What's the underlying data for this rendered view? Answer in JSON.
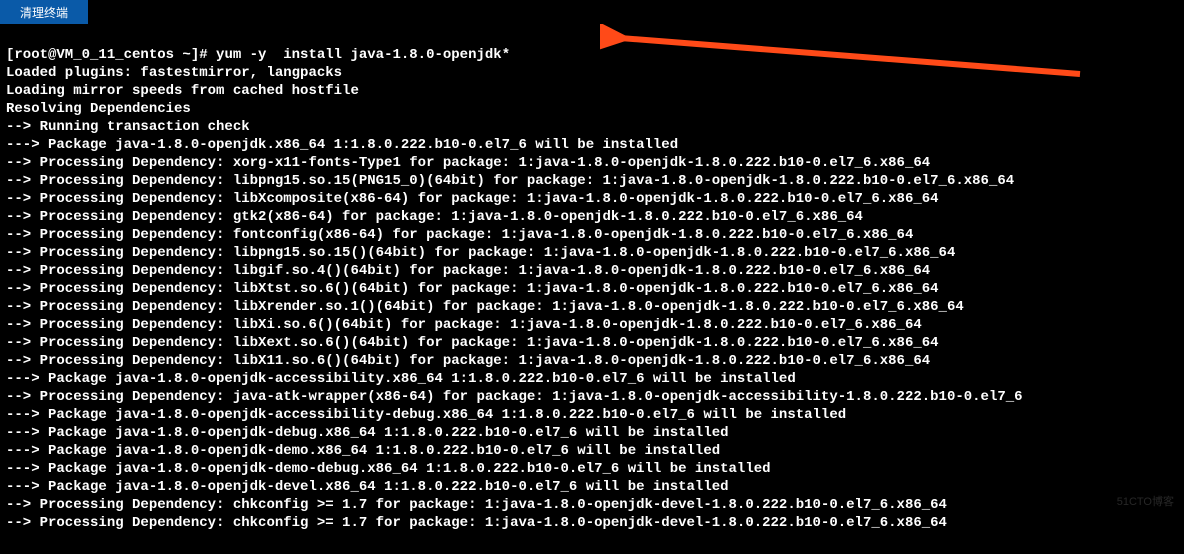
{
  "tab": {
    "label": "清理终端"
  },
  "prompt": {
    "text": "[root@VM_0_11_centos ~]#"
  },
  "command": {
    "text": "yum -y  install java-1.8.0-openjdk*"
  },
  "lines": [
    "Loaded plugins: fastestmirror, langpacks",
    "Loading mirror speeds from cached hostfile",
    "Resolving Dependencies",
    "--> Running transaction check",
    "---> Package java-1.8.0-openjdk.x86_64 1:1.8.0.222.b10-0.el7_6 will be installed",
    "--> Processing Dependency: xorg-x11-fonts-Type1 for package: 1:java-1.8.0-openjdk-1.8.0.222.b10-0.el7_6.x86_64",
    "--> Processing Dependency: libpng15.so.15(PNG15_0)(64bit) for package: 1:java-1.8.0-openjdk-1.8.0.222.b10-0.el7_6.x86_64",
    "--> Processing Dependency: libXcomposite(x86-64) for package: 1:java-1.8.0-openjdk-1.8.0.222.b10-0.el7_6.x86_64",
    "--> Processing Dependency: gtk2(x86-64) for package: 1:java-1.8.0-openjdk-1.8.0.222.b10-0.el7_6.x86_64",
    "--> Processing Dependency: fontconfig(x86-64) for package: 1:java-1.8.0-openjdk-1.8.0.222.b10-0.el7_6.x86_64",
    "--> Processing Dependency: libpng15.so.15()(64bit) for package: 1:java-1.8.0-openjdk-1.8.0.222.b10-0.el7_6.x86_64",
    "--> Processing Dependency: libgif.so.4()(64bit) for package: 1:java-1.8.0-openjdk-1.8.0.222.b10-0.el7_6.x86_64",
    "--> Processing Dependency: libXtst.so.6()(64bit) for package: 1:java-1.8.0-openjdk-1.8.0.222.b10-0.el7_6.x86_64",
    "--> Processing Dependency: libXrender.so.1()(64bit) for package: 1:java-1.8.0-openjdk-1.8.0.222.b10-0.el7_6.x86_64",
    "--> Processing Dependency: libXi.so.6()(64bit) for package: 1:java-1.8.0-openjdk-1.8.0.222.b10-0.el7_6.x86_64",
    "--> Processing Dependency: libXext.so.6()(64bit) for package: 1:java-1.8.0-openjdk-1.8.0.222.b10-0.el7_6.x86_64",
    "--> Processing Dependency: libX11.so.6()(64bit) for package: 1:java-1.8.0-openjdk-1.8.0.222.b10-0.el7_6.x86_64",
    "---> Package java-1.8.0-openjdk-accessibility.x86_64 1:1.8.0.222.b10-0.el7_6 will be installed",
    "--> Processing Dependency: java-atk-wrapper(x86-64) for package: 1:java-1.8.0-openjdk-accessibility-1.8.0.222.b10-0.el7_6",
    "---> Package java-1.8.0-openjdk-accessibility-debug.x86_64 1:1.8.0.222.b10-0.el7_6 will be installed",
    "---> Package java-1.8.0-openjdk-debug.x86_64 1:1.8.0.222.b10-0.el7_6 will be installed",
    "---> Package java-1.8.0-openjdk-demo.x86_64 1:1.8.0.222.b10-0.el7_6 will be installed",
    "---> Package java-1.8.0-openjdk-demo-debug.x86_64 1:1.8.0.222.b10-0.el7_6 will be installed",
    "---> Package java-1.8.0-openjdk-devel.x86_64 1:1.8.0.222.b10-0.el7_6 will be installed",
    "--> Processing Dependency: chkconfig >= 1.7 for package: 1:java-1.8.0-openjdk-devel-1.8.0.222.b10-0.el7_6.x86_64",
    "--> Processing Dependency: chkconfig >= 1.7 for package: 1:java-1.8.0-openjdk-devel-1.8.0.222.b10-0.el7_6.x86_64"
  ],
  "watermark": "51CTO博客"
}
